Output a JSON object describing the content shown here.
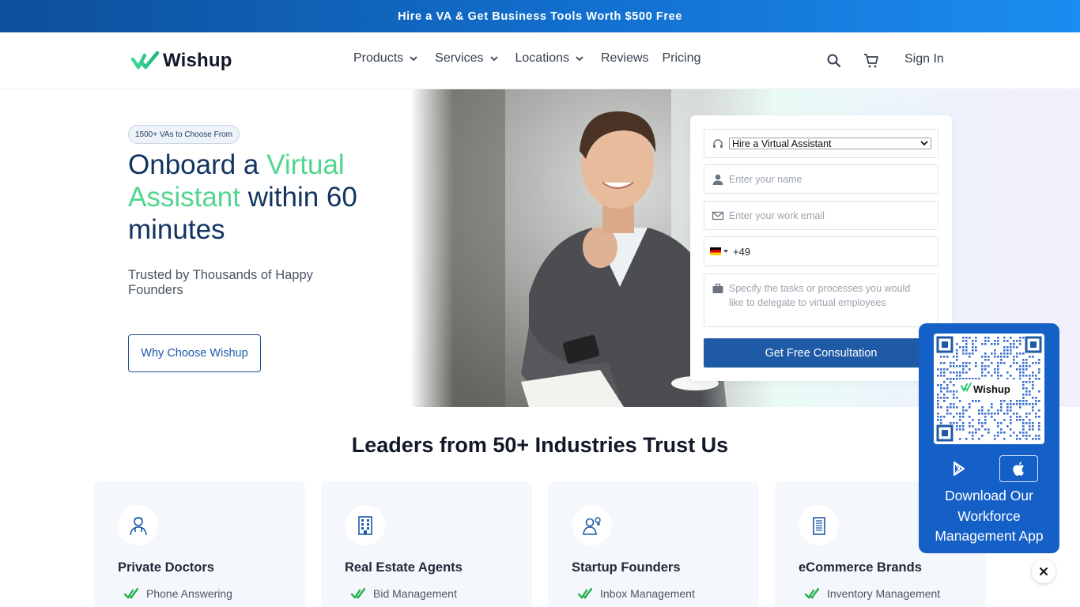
{
  "banner": {
    "text": "Hire a VA & Get Business Tools Worth $500 Free"
  },
  "header": {
    "logo_text": "Wishup",
    "nav": [
      {
        "label": "Products",
        "dropdown": true
      },
      {
        "label": "Services",
        "dropdown": true
      },
      {
        "label": "Locations",
        "dropdown": true
      },
      {
        "label": "Reviews",
        "dropdown": false
      },
      {
        "label": "Pricing",
        "dropdown": false
      }
    ],
    "icons": [
      "search-icon",
      "cart-icon"
    ],
    "sign_in": "Sign In"
  },
  "hero": {
    "badge": "1500+ VAs to Choose From",
    "title_part1": "Onboard a ",
    "title_accent": "Virtual Assistant",
    "title_part2": " within 60 minutes",
    "subtitle": "Trusted by Thousands of Happy Founders",
    "cta": "Why Choose Wishup",
    "accent_color": "#52d68f",
    "title_color": "#123462"
  },
  "form": {
    "service_select": "Hire a Virtual Assistant",
    "name_placeholder": "Enter your name",
    "email_placeholder": "Enter your work email",
    "phone_code": "+49",
    "tasks_placeholder": "Specify the tasks or processes you would like to delegate to virtual employees",
    "submit": "Get Free Consultation",
    "button_color": "#1e5aa6"
  },
  "industries": {
    "title": "Leaders from 50+ Industries Trust Us",
    "cards": [
      {
        "title": "Private Doctors",
        "item": "Phone Answering",
        "icon": "doctor-icon"
      },
      {
        "title": "Real Estate Agents",
        "item": "Bid Management",
        "icon": "building-icon"
      },
      {
        "title": "Startup Founders",
        "item": "Inbox Management",
        "icon": "founder-icon"
      },
      {
        "title": "eCommerce Brands",
        "item": "Inventory Management",
        "icon": "office-icon"
      }
    ]
  },
  "app_promo": {
    "qr_label": "Wishup",
    "text": "Download Our Workforce Management App",
    "background": "#1560c7"
  }
}
